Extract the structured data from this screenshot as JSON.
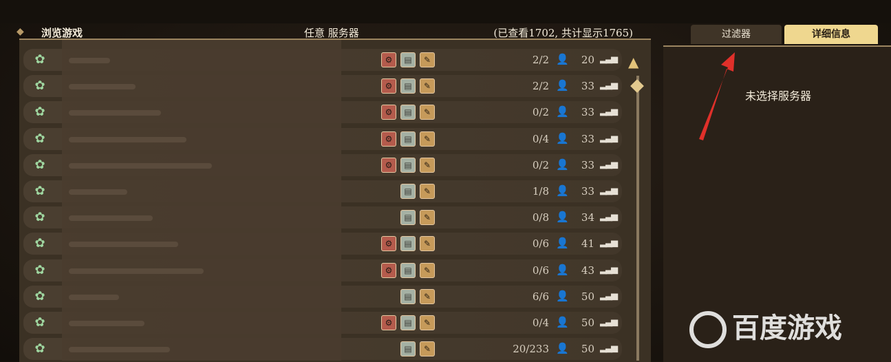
{
  "header": {
    "title": "浏览游戏",
    "server_filter": "任意 服务器",
    "count_text": "(已查看1702, 共计显示1765)"
  },
  "tabs": [
    {
      "label": "过滤器"
    },
    {
      "label": "详细信息"
    }
  ],
  "details": {
    "empty_text": "未选择服务器"
  },
  "watermark": {
    "text": "百度游戏"
  },
  "icons": {
    "mod": "mods-icon",
    "dedicated": "dedicated-server-icon",
    "settings": "wrench-icon",
    "player": "player-icon",
    "ping": "signal-bars-icon",
    "scroll_up": "scroll-up-arrow-icon"
  },
  "colors": {
    "accent_gold": "#efd78f",
    "panel_bg": "#3b3124",
    "arrow_red": "#e0302a"
  },
  "servers": [
    {
      "players": "2/2",
      "ping": "20",
      "mods": true
    },
    {
      "players": "2/2",
      "ping": "33",
      "mods": true
    },
    {
      "players": "0/2",
      "ping": "33",
      "mods": true
    },
    {
      "players": "0/4",
      "ping": "33",
      "mods": true
    },
    {
      "players": "0/2",
      "ping": "33",
      "mods": true
    },
    {
      "players": "1/8",
      "ping": "33",
      "mods": false
    },
    {
      "players": "0/8",
      "ping": "34",
      "mods": false
    },
    {
      "players": "0/6",
      "ping": "41",
      "mods": true
    },
    {
      "players": "0/6",
      "ping": "43",
      "mods": true
    },
    {
      "players": "6/6",
      "ping": "50",
      "mods": false
    },
    {
      "players": "0/4",
      "ping": "50",
      "mods": true
    },
    {
      "players": "20/233",
      "ping": "50",
      "mods": false
    }
  ]
}
